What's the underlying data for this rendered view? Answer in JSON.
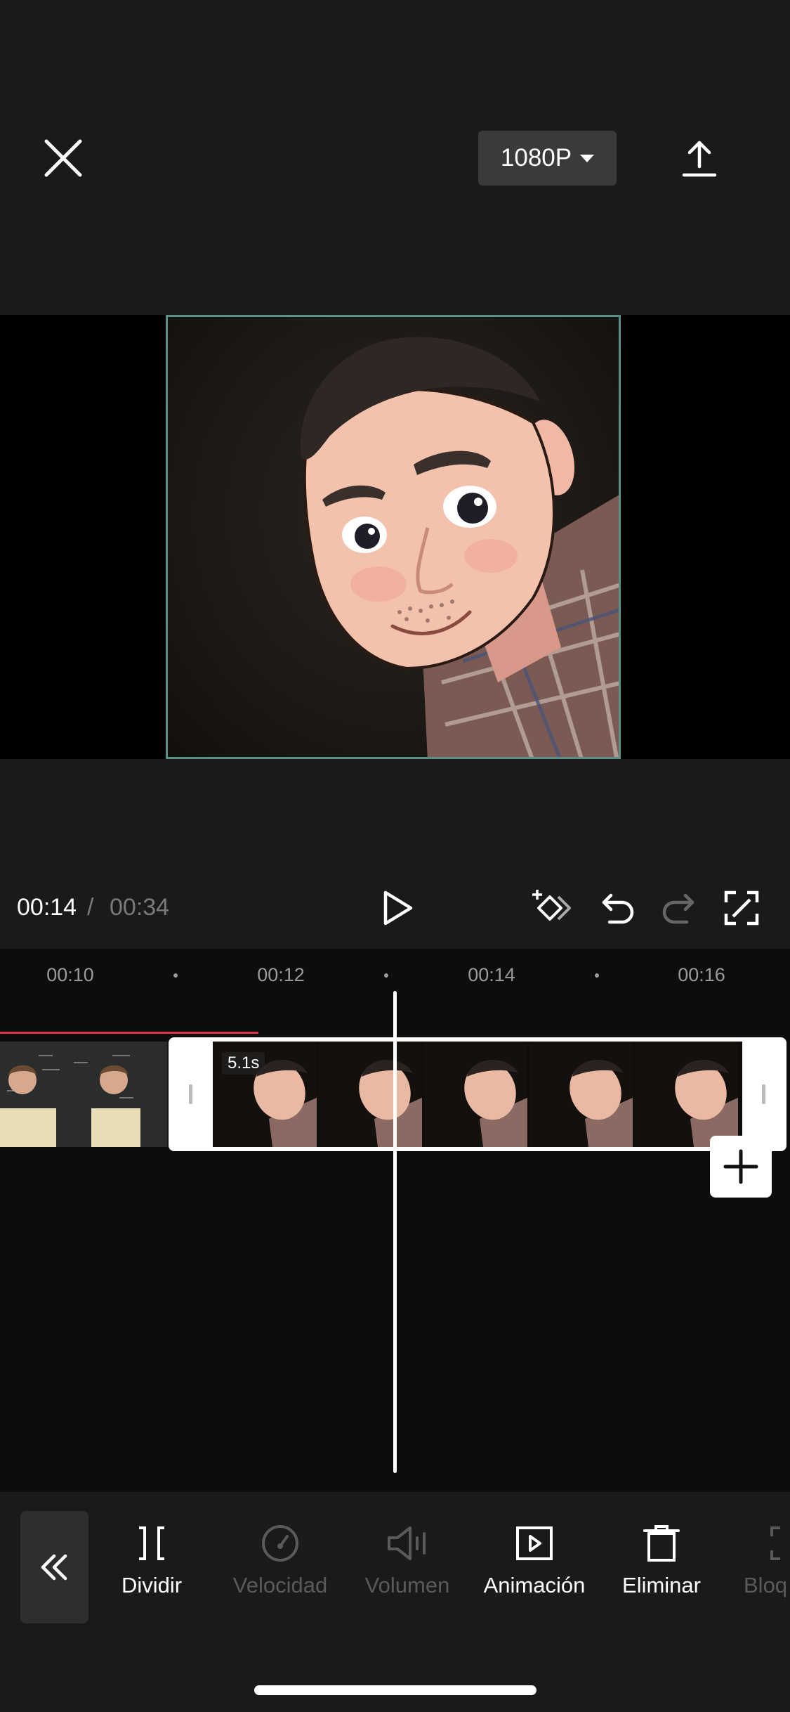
{
  "header": {
    "resolution_label": "1080P",
    "close_icon": "close-icon",
    "export_icon": "export-icon"
  },
  "playback": {
    "current_time": "00:14",
    "separator": "/",
    "total_time": "00:34"
  },
  "ruler": {
    "labels": [
      "00:10",
      "00:12",
      "00:14",
      "00:16"
    ]
  },
  "timeline": {
    "selected_clip_duration": "5.1s"
  },
  "toolbar": {
    "items": [
      {
        "label": "Dividir",
        "icon": "split-icon",
        "enabled": true
      },
      {
        "label": "Velocidad",
        "icon": "speed-icon",
        "enabled": false
      },
      {
        "label": "Volumen",
        "icon": "volume-icon",
        "enabled": false
      },
      {
        "label": "Animación",
        "icon": "animation-icon",
        "enabled": true
      },
      {
        "label": "Eliminar",
        "icon": "trash-icon",
        "enabled": true
      },
      {
        "label": "Bloq",
        "icon": "lock-icon",
        "enabled": false
      }
    ]
  },
  "colors": {
    "accent_frame": "#5e8f86",
    "progress_red": "#e0324c",
    "background": "#1a1a1a"
  }
}
